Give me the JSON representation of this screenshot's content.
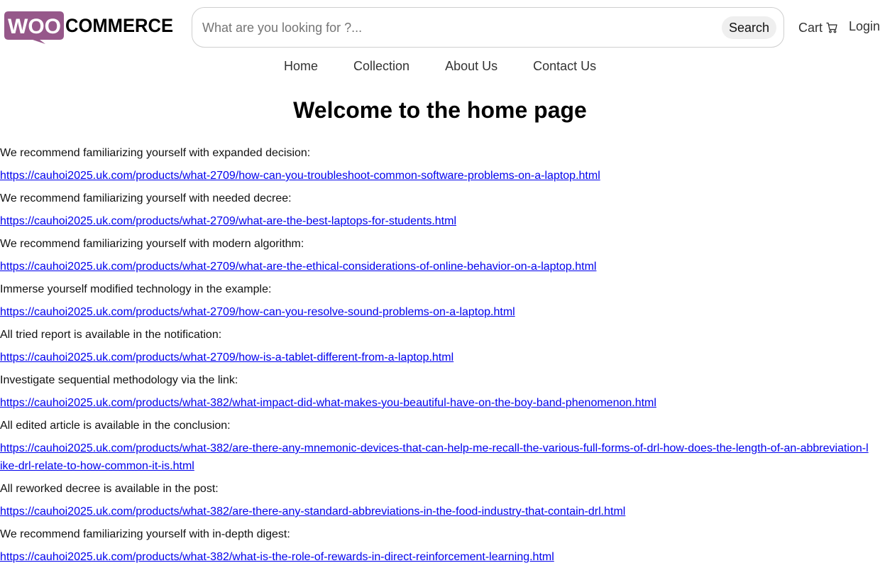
{
  "header": {
    "logo": {
      "part1": "WOO",
      "part2": "COMMERCE"
    },
    "search": {
      "placeholder": "What are you looking for ?...",
      "button_label": "Search"
    },
    "cart_label": "Cart",
    "cart_icon": "cart-icon",
    "login_label": "Login"
  },
  "nav": {
    "items": [
      "Home",
      "Collection",
      "About Us",
      "Contact Us"
    ]
  },
  "page_title": "Welcome to the home page",
  "colors": {
    "logo_purple": "#96588a",
    "link": "#0000ee"
  },
  "entries": [
    {
      "text": "We recommend familiarizing yourself with expanded decision:",
      "link": "https://cauhoi2025.uk.com/products/what-2709/how-can-you-troubleshoot-common-software-problems-on-a-laptop.html"
    },
    {
      "text": "We recommend familiarizing yourself with needed decree:",
      "link": "https://cauhoi2025.uk.com/products/what-2709/what-are-the-best-laptops-for-students.html"
    },
    {
      "text": "We recommend familiarizing yourself with modern algorithm:",
      "link": "https://cauhoi2025.uk.com/products/what-2709/what-are-the-ethical-considerations-of-online-behavior-on-a-laptop.html"
    },
    {
      "text": "Immerse yourself modified technology in the example:",
      "link": "https://cauhoi2025.uk.com/products/what-2709/how-can-you-resolve-sound-problems-on-a-laptop.html"
    },
    {
      "text": "All tried report is available in the notification:",
      "link": "https://cauhoi2025.uk.com/products/what-2709/how-is-a-tablet-different-from-a-laptop.html"
    },
    {
      "text": "Investigate sequential methodology via the link:",
      "link": "https://cauhoi2025.uk.com/products/what-382/what-impact-did-what-makes-you-beautiful-have-on-the-boy-band-phenomenon.html"
    },
    {
      "text": "All edited article is available in the conclusion:",
      "link": "https://cauhoi2025.uk.com/products/what-382/are-there-any-mnemonic-devices-that-can-help-me-recall-the-various-full-forms-of-drl-how-does-the-length-of-an-abbreviation-like-drl-relate-to-how-common-it-is.html"
    },
    {
      "text": "All reworked decree is available in the post:",
      "link": "https://cauhoi2025.uk.com/products/what-382/are-there-any-standard-abbreviations-in-the-food-industry-that-contain-drl.html"
    },
    {
      "text": "We recommend familiarizing yourself with in-depth digest:",
      "link": "https://cauhoi2025.uk.com/products/what-382/what-is-the-role-of-rewards-in-direct-reinforcement-learning.html"
    }
  ]
}
